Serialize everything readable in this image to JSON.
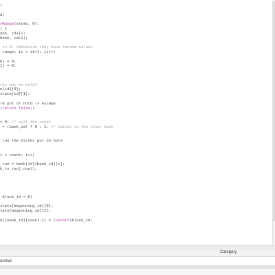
{
  "editor": {
    "lines": [
      ")",
      "",
      "d;",
      "",
      "yRange(state, 0);",
      ") {",
      "ank, id+1);",
      "bank, id+1);",
      "",
      " to 0, otherwise they have random values",
      " range; ii < id+1; ii++)",
      "",
      "0] = 0;",
      "1] = 0;",
      "",
      "",
      "",
      "cks put on hold?",
      "e[id][0];",
      "state[id][1];",
      "",
      "re put on hold -> escape",
      "(return false;)",
      "",
      "",
      "= 0; // null the count",
      " = (bank_id) ? 0 : 1; // switch to the other bank",
      "",
      "",
      " run the blocks put on hold",
      "",
      "",
      "i < count; i++)",
      "",
      "_run = bank[id][bank_id][i];",
      "k_to_run].run();",
      "",
      "",
      "",
      "",
      "",
      " block_id = 0)",
      "",
      "state[beginning_id][0];",
      "tate[beginning_id][1];",
      "",
      "d][bank_id][count-1] = (ushort)block_id;",
      "",
      "",
      ""
    ]
  },
  "panel": {
    "column_header": "Category",
    "tab_label": "ournal"
  },
  "colors": {
    "code_text": "#4a4a4a",
    "function_call": "#b0409a",
    "comment": "#9aa0a6"
  }
}
